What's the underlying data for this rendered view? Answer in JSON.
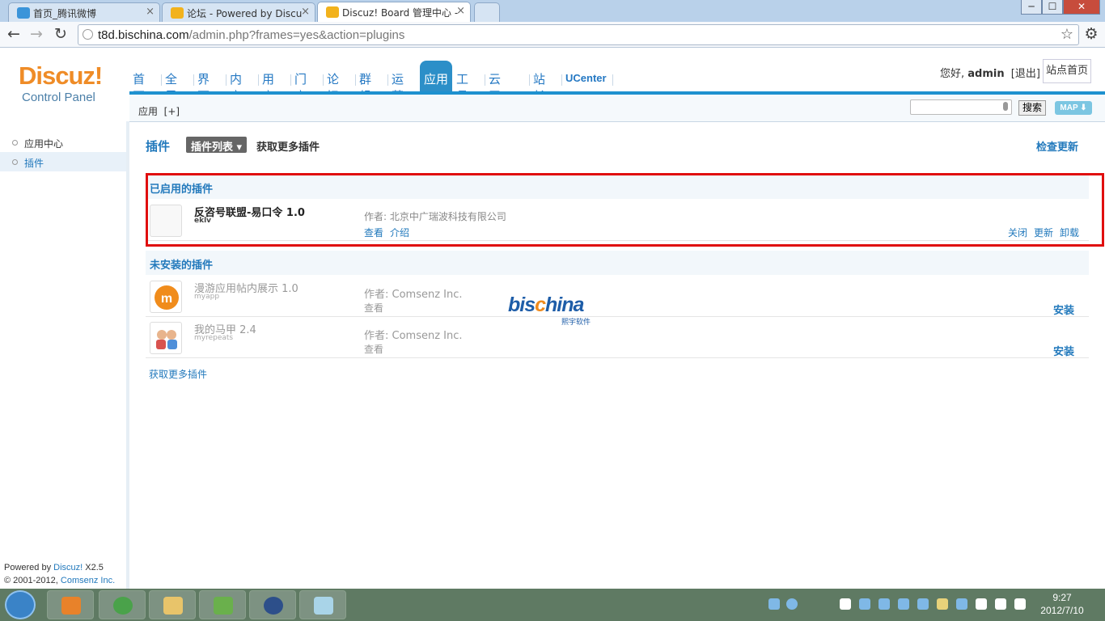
{
  "browser": {
    "tabs": [
      {
        "title": "首页_腾讯微博",
        "icon": "tencent-weibo-icon"
      },
      {
        "title": "论坛 - Powered by Discu",
        "icon": "discuz-favicon-icon"
      },
      {
        "title": "Discuz! Board 管理中心 -",
        "icon": "discuz-favicon-icon"
      }
    ],
    "close_glyph": "×",
    "url_host": "t8d.bischina.com",
    "url_path": "/admin.php?frames=yes&action=plugins",
    "window_buttons": {
      "minimize": "─",
      "maximize": "☐",
      "close": "✕"
    }
  },
  "header": {
    "logo_text": "Discuz!",
    "logo_sub": "Control Panel",
    "nav": [
      "首页",
      "全局",
      "界面",
      "内容",
      "用户",
      "门户",
      "论坛",
      "群组",
      "运营",
      "应用",
      "工具",
      "云平台",
      "站长",
      "UCenter"
    ],
    "active_nav": "应用",
    "greeting_prefix": "您好, ",
    "username": "admin",
    "logout": "[退出]",
    "site_home": "站点首页"
  },
  "subbar": {
    "crumb": "应用",
    "crumb_add": "[+]",
    "search_button": "搜索",
    "map_button": "MAP ⬇"
  },
  "sidebar": {
    "items": [
      {
        "label": "应用中心"
      },
      {
        "label": "插件"
      }
    ],
    "footer_powered": "Powered by ",
    "footer_brand": "Discuz!",
    "footer_version": " X2.5",
    "footer_copy": "© 2001-2012, ",
    "footer_company": "Comsenz Inc."
  },
  "main": {
    "title": "插件",
    "list_button": "插件列表 ▾",
    "get_more_top": "获取更多插件",
    "check_update": "检查更新",
    "enabled_header": "已启用的插件",
    "enabled_plugins": [
      {
        "name": "反咨号联盟-易口令 1.0",
        "id": "eklv",
        "author": "作者: 北京中广瑞波科技有限公司",
        "links": [
          "查看",
          "介绍"
        ],
        "actions": [
          "关闭",
          "更新",
          "卸载"
        ]
      }
    ],
    "uninstalled_header": "未安装的插件",
    "uninstalled_plugins": [
      {
        "name": "漫游应用帖内展示 1.0",
        "id": "myapp",
        "author": "作者: Comsenz Inc.",
        "link": "查看",
        "install": "安装"
      },
      {
        "name": "我的马甲 2.4",
        "id": "myrepeats",
        "author": "作者: Comsenz Inc.",
        "link": "查看",
        "install": "安装"
      }
    ],
    "get_more_bottom": "获取更多插件"
  },
  "watermark": {
    "text_a": "bis",
    "text_b": "c",
    "text_c": "hina",
    "sub": "熙宇软件"
  },
  "taskbar": {
    "apps": [
      "media-player-icon",
      "chrome-icon",
      "explorer-folder-icon",
      "network-icon",
      "media-center-icon",
      "notes-icon"
    ],
    "time": "9:27",
    "date": "2012/7/10"
  },
  "colors": {
    "accent": "#2279bc",
    "logo": "#ef8c27",
    "highlight_box": "#e00e0e"
  }
}
